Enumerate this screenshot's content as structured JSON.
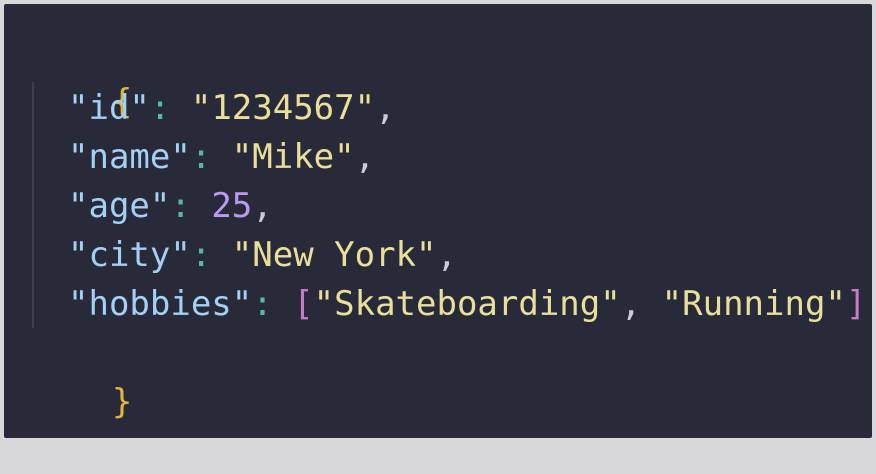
{
  "editor": {
    "open_brace": "{",
    "close_brace": "}",
    "lines": [
      {
        "key": "\"id\"",
        "value": "\"1234567\"",
        "value_type": "string",
        "trail": ","
      },
      {
        "key": "\"name\"",
        "value": "\"Mike\"",
        "value_type": "string",
        "trail": ","
      },
      {
        "key": "\"age\"",
        "value": "25",
        "value_type": "number",
        "trail": ","
      },
      {
        "key": "\"city\"",
        "value": "\"New York\"",
        "value_type": "string",
        "trail": ","
      },
      {
        "key": "\"hobbies\"",
        "array_open": "[",
        "items": [
          "\"Skateboarding\"",
          "\"Running\""
        ],
        "item_sep": ", ",
        "array_close": "]",
        "value_type": "array"
      }
    ],
    "colon": ": "
  },
  "colors": {
    "background": "#292a39",
    "brace": "#e2b43a",
    "key": "#a4d0f4",
    "string": "#e8e09a",
    "number": "#b99bf2",
    "bracket": "#c77ac9",
    "colon": "#55b8b0"
  }
}
